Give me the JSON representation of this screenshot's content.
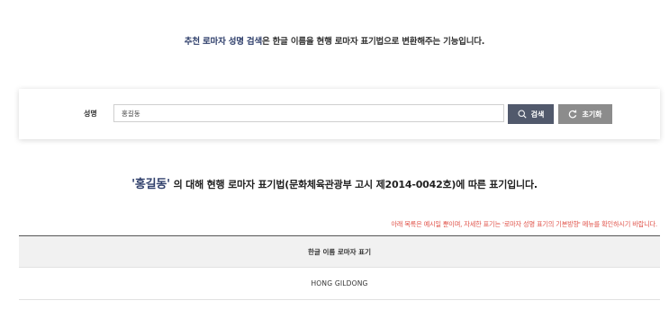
{
  "intro": {
    "accent": "추천 로마자 성명 검색",
    "rest": "은 한글 이름을 현행 로마자 표기법으로 변환해주는 기능입니다."
  },
  "search": {
    "label": "성명",
    "value": "홍길동",
    "search_label": "검색",
    "reset_label": "초기화"
  },
  "result": {
    "name_quoted": "'홍길동'",
    "heading_rest": " 의 대해 현행 로마자 표기법(문화체육관광부 고시 제2014-0042호)에 따른 표기입니다.",
    "notice": "아래 목록은 예시일 뿐이며, 자세한 표기는 '로마자 성명 표기의 기본방향' 메뉴를 확인하시기 바랍니다.",
    "table": {
      "header": "한글 이름 로마자 표기",
      "rows": [
        "HONG GILDONG"
      ]
    }
  },
  "colors": {
    "accent": "#2f3f6b",
    "search_button": "#51596c",
    "reset_button": "#8c8c8c",
    "notice": "#e0534a"
  }
}
